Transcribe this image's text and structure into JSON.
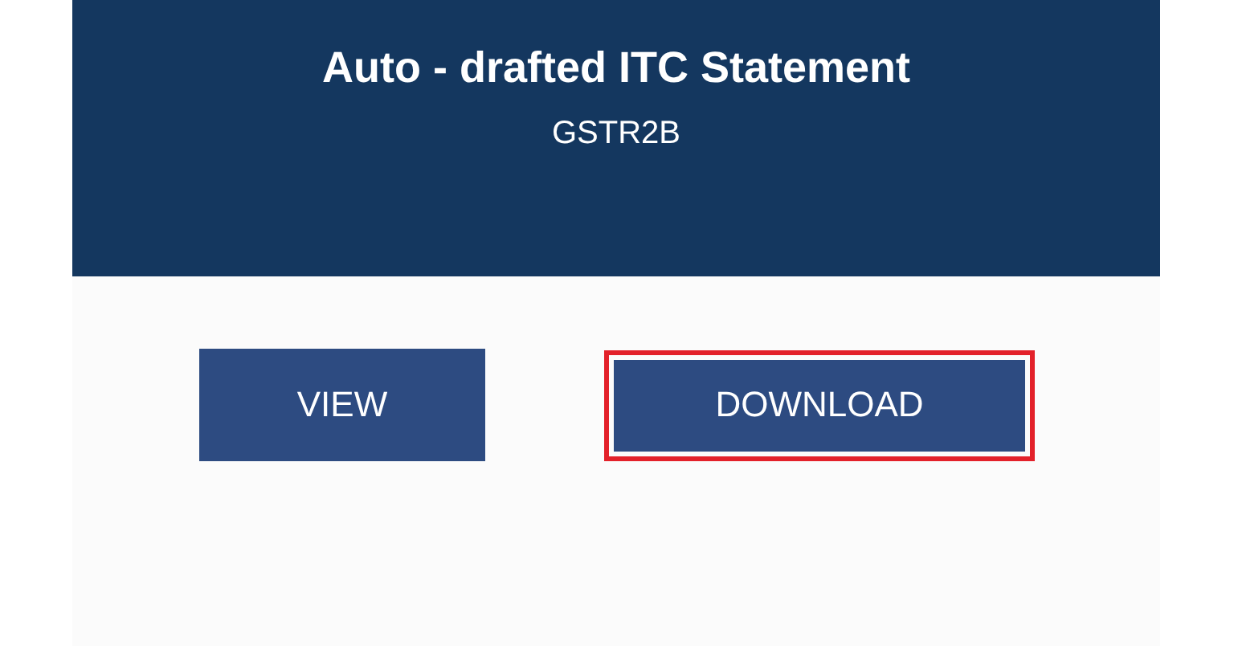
{
  "header": {
    "title": "Auto - drafted ITC Statement",
    "subtitle": "GSTR2B"
  },
  "buttons": [
    {
      "label": "VIEW",
      "highlighted": false
    },
    {
      "label": "DOWNLOAD",
      "highlighted": true
    }
  ]
}
